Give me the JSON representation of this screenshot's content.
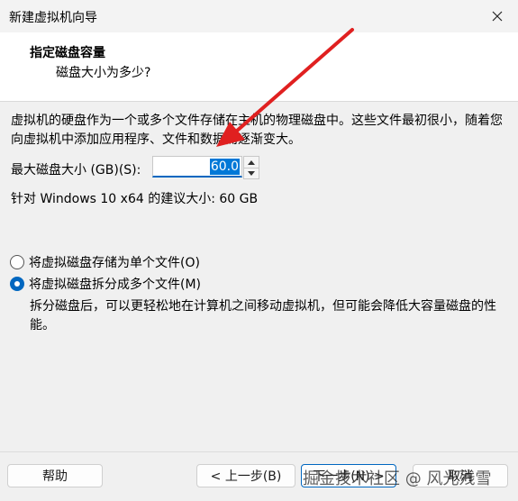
{
  "window": {
    "title": "新建虚拟机向导"
  },
  "header": {
    "title": "指定磁盘容量",
    "subtitle": "磁盘大小为多少?"
  },
  "description": "虚拟机的硬盘作为一个或多个文件存储在主机的物理磁盘中。这些文件最初很小，随着您向虚拟机中添加应用程序、文件和数据而逐渐变大。",
  "disk_size": {
    "label": "最大磁盘大小 (GB)(S):",
    "value": "60.0"
  },
  "recommendation": "针对 Windows 10 x64 的建议大小: 60 GB",
  "options": {
    "single_label": "将虚拟磁盘存储为单个文件(O)",
    "multi_label": "将虚拟磁盘拆分成多个文件(M)",
    "selected": "multi",
    "multi_description": "拆分磁盘后，可以更轻松地在计算机之间移动虚拟机，但可能会降低大容量磁盘的性能。"
  },
  "buttons": {
    "help": "帮助",
    "back": "< 上一步(B)",
    "next": "下一步(N) >",
    "cancel": "取消"
  },
  "watermark": "掘金技术社区 @ 风光残雪",
  "colors": {
    "accent": "#0067c0",
    "annotation_arrow": "#e02020"
  }
}
